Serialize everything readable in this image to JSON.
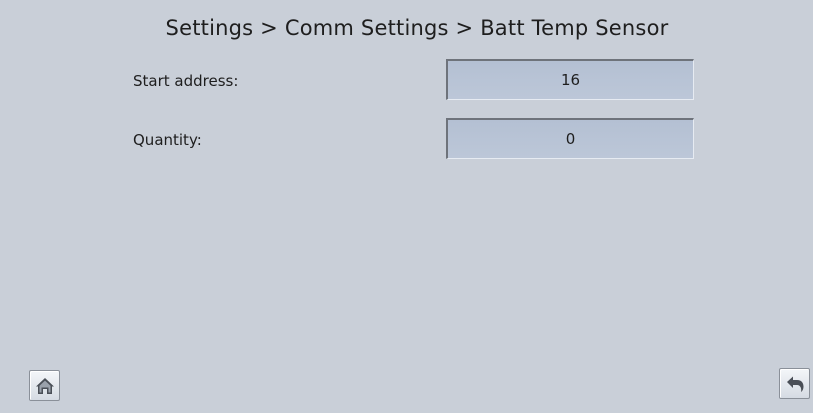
{
  "header": {
    "breadcrumb": "Settings > Comm Settings > Batt Temp Sensor"
  },
  "form": {
    "rows": [
      {
        "label": "Start address:",
        "value": "16"
      },
      {
        "label": "Quantity:",
        "value": "0"
      }
    ]
  },
  "footer": {
    "home_icon": "home-icon",
    "back_icon": "back-arrow-icon"
  },
  "colors": {
    "background": "#c9cfd8",
    "field_fill": "#b8c3d5"
  }
}
